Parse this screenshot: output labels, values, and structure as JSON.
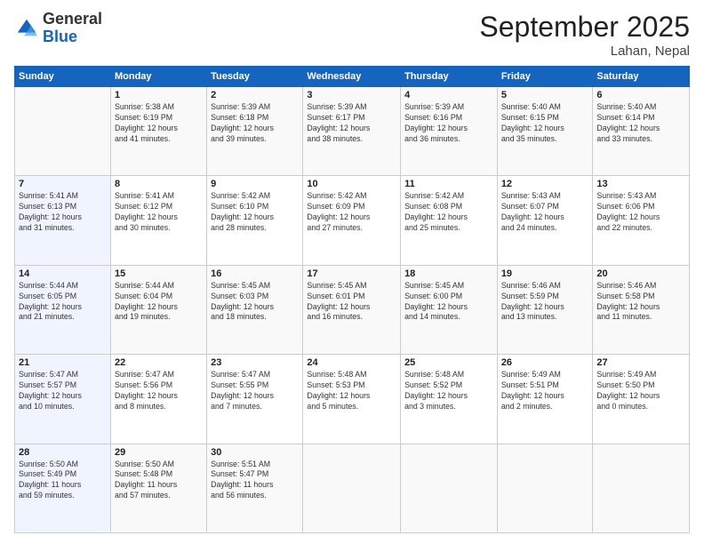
{
  "logo": {
    "general": "General",
    "blue": "Blue"
  },
  "header": {
    "month": "September 2025",
    "location": "Lahan, Nepal"
  },
  "weekdays": [
    "Sunday",
    "Monday",
    "Tuesday",
    "Wednesday",
    "Thursday",
    "Friday",
    "Saturday"
  ],
  "weeks": [
    [
      {
        "day": "",
        "info": ""
      },
      {
        "day": "1",
        "info": "Sunrise: 5:38 AM\nSunset: 6:19 PM\nDaylight: 12 hours\nand 41 minutes."
      },
      {
        "day": "2",
        "info": "Sunrise: 5:39 AM\nSunset: 6:18 PM\nDaylight: 12 hours\nand 39 minutes."
      },
      {
        "day": "3",
        "info": "Sunrise: 5:39 AM\nSunset: 6:17 PM\nDaylight: 12 hours\nand 38 minutes."
      },
      {
        "day": "4",
        "info": "Sunrise: 5:39 AM\nSunset: 6:16 PM\nDaylight: 12 hours\nand 36 minutes."
      },
      {
        "day": "5",
        "info": "Sunrise: 5:40 AM\nSunset: 6:15 PM\nDaylight: 12 hours\nand 35 minutes."
      },
      {
        "day": "6",
        "info": "Sunrise: 5:40 AM\nSunset: 6:14 PM\nDaylight: 12 hours\nand 33 minutes."
      }
    ],
    [
      {
        "day": "7",
        "info": "Sunrise: 5:41 AM\nSunset: 6:13 PM\nDaylight: 12 hours\nand 31 minutes."
      },
      {
        "day": "8",
        "info": "Sunrise: 5:41 AM\nSunset: 6:12 PM\nDaylight: 12 hours\nand 30 minutes."
      },
      {
        "day": "9",
        "info": "Sunrise: 5:42 AM\nSunset: 6:10 PM\nDaylight: 12 hours\nand 28 minutes."
      },
      {
        "day": "10",
        "info": "Sunrise: 5:42 AM\nSunset: 6:09 PM\nDaylight: 12 hours\nand 27 minutes."
      },
      {
        "day": "11",
        "info": "Sunrise: 5:42 AM\nSunset: 6:08 PM\nDaylight: 12 hours\nand 25 minutes."
      },
      {
        "day": "12",
        "info": "Sunrise: 5:43 AM\nSunset: 6:07 PM\nDaylight: 12 hours\nand 24 minutes."
      },
      {
        "day": "13",
        "info": "Sunrise: 5:43 AM\nSunset: 6:06 PM\nDaylight: 12 hours\nand 22 minutes."
      }
    ],
    [
      {
        "day": "14",
        "info": "Sunrise: 5:44 AM\nSunset: 6:05 PM\nDaylight: 12 hours\nand 21 minutes."
      },
      {
        "day": "15",
        "info": "Sunrise: 5:44 AM\nSunset: 6:04 PM\nDaylight: 12 hours\nand 19 minutes."
      },
      {
        "day": "16",
        "info": "Sunrise: 5:45 AM\nSunset: 6:03 PM\nDaylight: 12 hours\nand 18 minutes."
      },
      {
        "day": "17",
        "info": "Sunrise: 5:45 AM\nSunset: 6:01 PM\nDaylight: 12 hours\nand 16 minutes."
      },
      {
        "day": "18",
        "info": "Sunrise: 5:45 AM\nSunset: 6:00 PM\nDaylight: 12 hours\nand 14 minutes."
      },
      {
        "day": "19",
        "info": "Sunrise: 5:46 AM\nSunset: 5:59 PM\nDaylight: 12 hours\nand 13 minutes."
      },
      {
        "day": "20",
        "info": "Sunrise: 5:46 AM\nSunset: 5:58 PM\nDaylight: 12 hours\nand 11 minutes."
      }
    ],
    [
      {
        "day": "21",
        "info": "Sunrise: 5:47 AM\nSunset: 5:57 PM\nDaylight: 12 hours\nand 10 minutes."
      },
      {
        "day": "22",
        "info": "Sunrise: 5:47 AM\nSunset: 5:56 PM\nDaylight: 12 hours\nand 8 minutes."
      },
      {
        "day": "23",
        "info": "Sunrise: 5:47 AM\nSunset: 5:55 PM\nDaylight: 12 hours\nand 7 minutes."
      },
      {
        "day": "24",
        "info": "Sunrise: 5:48 AM\nSunset: 5:53 PM\nDaylight: 12 hours\nand 5 minutes."
      },
      {
        "day": "25",
        "info": "Sunrise: 5:48 AM\nSunset: 5:52 PM\nDaylight: 12 hours\nand 3 minutes."
      },
      {
        "day": "26",
        "info": "Sunrise: 5:49 AM\nSunset: 5:51 PM\nDaylight: 12 hours\nand 2 minutes."
      },
      {
        "day": "27",
        "info": "Sunrise: 5:49 AM\nSunset: 5:50 PM\nDaylight: 12 hours\nand 0 minutes."
      }
    ],
    [
      {
        "day": "28",
        "info": "Sunrise: 5:50 AM\nSunset: 5:49 PM\nDaylight: 11 hours\nand 59 minutes."
      },
      {
        "day": "29",
        "info": "Sunrise: 5:50 AM\nSunset: 5:48 PM\nDaylight: 11 hours\nand 57 minutes."
      },
      {
        "day": "30",
        "info": "Sunrise: 5:51 AM\nSunset: 5:47 PM\nDaylight: 11 hours\nand 56 minutes."
      },
      {
        "day": "",
        "info": ""
      },
      {
        "day": "",
        "info": ""
      },
      {
        "day": "",
        "info": ""
      },
      {
        "day": "",
        "info": ""
      }
    ]
  ]
}
